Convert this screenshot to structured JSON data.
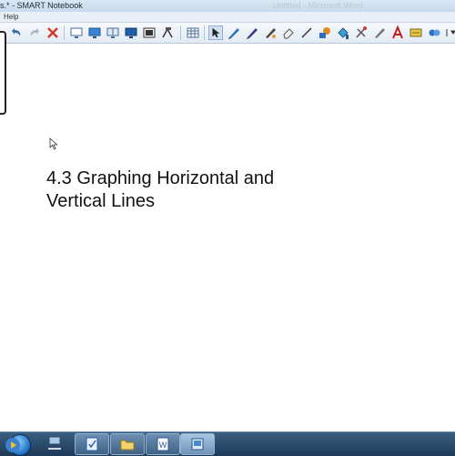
{
  "window": {
    "title": "s.* - SMART Notebook",
    "ghost_title": "Untitled - Microsoft Word"
  },
  "menu": {
    "items": [
      "Help"
    ]
  },
  "toolbar": {
    "buttons": [
      "undo-icon",
      "redo-icon",
      "delete-icon",
      "screen-shade-icon",
      "full-screen-icon",
      "dual-page-icon",
      "monitor-icon",
      "capture-icon",
      "document-camera-icon",
      "table-icon",
      "select-icon",
      "pen-icon",
      "creative-pen-icon",
      "magic-pen-icon",
      "eraser-icon",
      "line-icon",
      "shapes-icon",
      "fill-icon",
      "properties-icon",
      "pen-tool-icon",
      "text-icon",
      "highlighter-icon",
      "more-icon"
    ]
  },
  "page": {
    "heading_line1": "4.3 Graphing Horizontal and",
    "heading_line2": "Vertical Lines"
  },
  "taskbar": {
    "items": [
      "media-player-icon",
      "network-icon",
      "notes-icon",
      "file-explorer-icon",
      "word-icon",
      "notebook-icon"
    ]
  },
  "colors": {
    "accent": "#1c6fc2",
    "taskbar": "#1d3957"
  }
}
